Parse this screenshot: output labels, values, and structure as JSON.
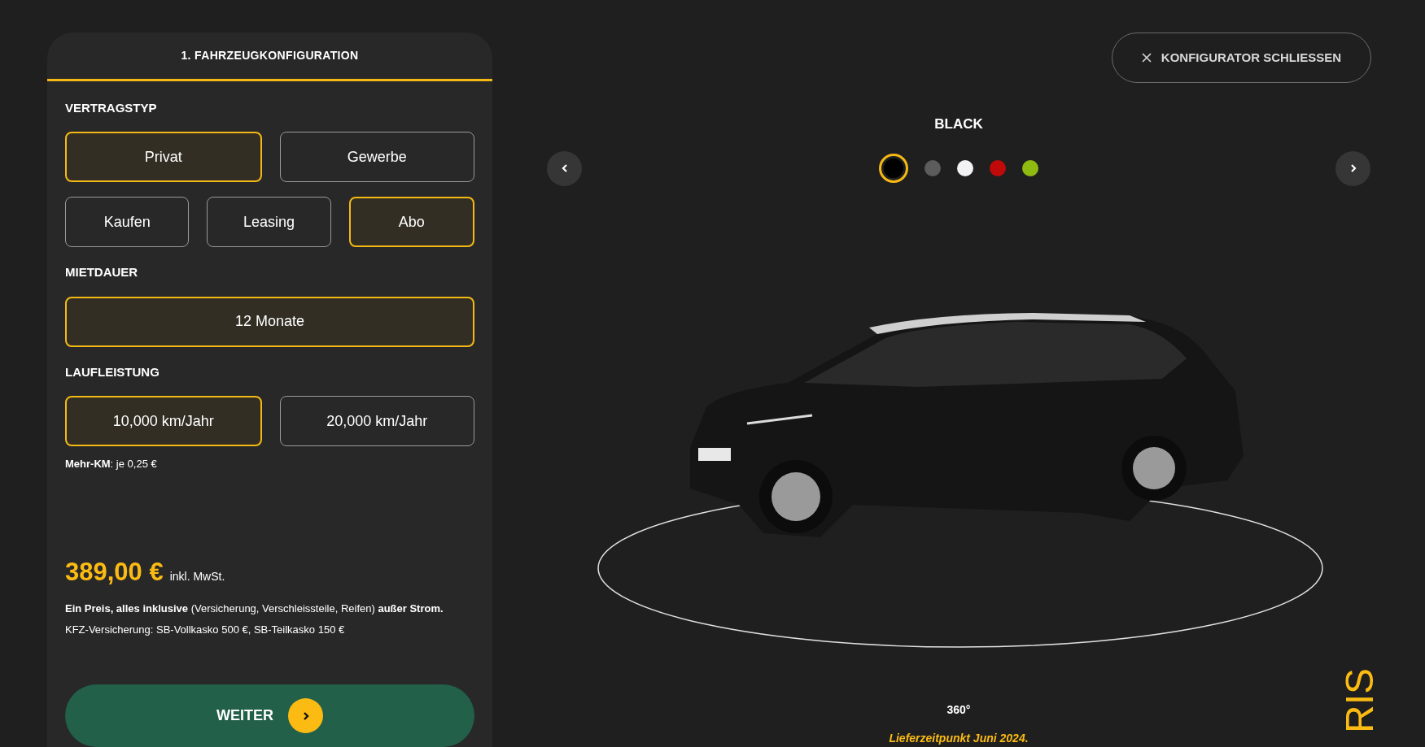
{
  "panel": {
    "title": "1. FAHRZEUGKONFIGURATION",
    "sections": [
      {
        "heading": "VERTRAGSTYP",
        "rows": [
          [
            {
              "label": "Privat",
              "selected": true
            },
            {
              "label": "Gewerbe",
              "selected": false
            }
          ],
          [
            {
              "label": "Kaufen",
              "selected": false
            },
            {
              "label": "Leasing",
              "selected": false
            },
            {
              "label": "Abo",
              "selected": true
            }
          ]
        ]
      },
      {
        "heading": "MIETDAUER",
        "rows": [
          [
            {
              "label": "12 Monate",
              "selected": true
            }
          ]
        ]
      },
      {
        "heading": "LAUFLEISTUNG",
        "rows": [
          [
            {
              "label": "10,000 km/Jahr",
              "selected": true
            },
            {
              "label": "20,000 km/Jahr",
              "selected": false
            }
          ]
        ],
        "note": "**Mehr-KM**: je 0,25 €"
      }
    ],
    "price": "389,00 €",
    "price_suffix": "inkl. MwSt.",
    "price_note": "**Ein Preis, alles inklusive** (Versicherung, Verschleissteile, Reifen) **außer Strom.**",
    "insurance_note": "KFZ-Versicherung: SB-Vollkasko 500 €, SB-Teilkasko 150 €",
    "next_button": {
      "label": "WEITER"
    }
  },
  "viewer": {
    "close_button": {
      "label": "KONFIGURATOR SCHLIESSEN"
    },
    "color_name": "BLACK",
    "swatches": [
      {
        "color": "#000000",
        "selected": true
      },
      {
        "color": "#5c5c5c",
        "selected": false
      },
      {
        "color": "#f2f2f4",
        "selected": false
      },
      {
        "color": "#c00a0a",
        "selected": false
      },
      {
        "color": "#8fba12",
        "selected": false
      }
    ],
    "view_label": "360°",
    "delivery_note": "Lieferzeitpunkt Juni 2024.",
    "brand_partial": "RIS"
  }
}
